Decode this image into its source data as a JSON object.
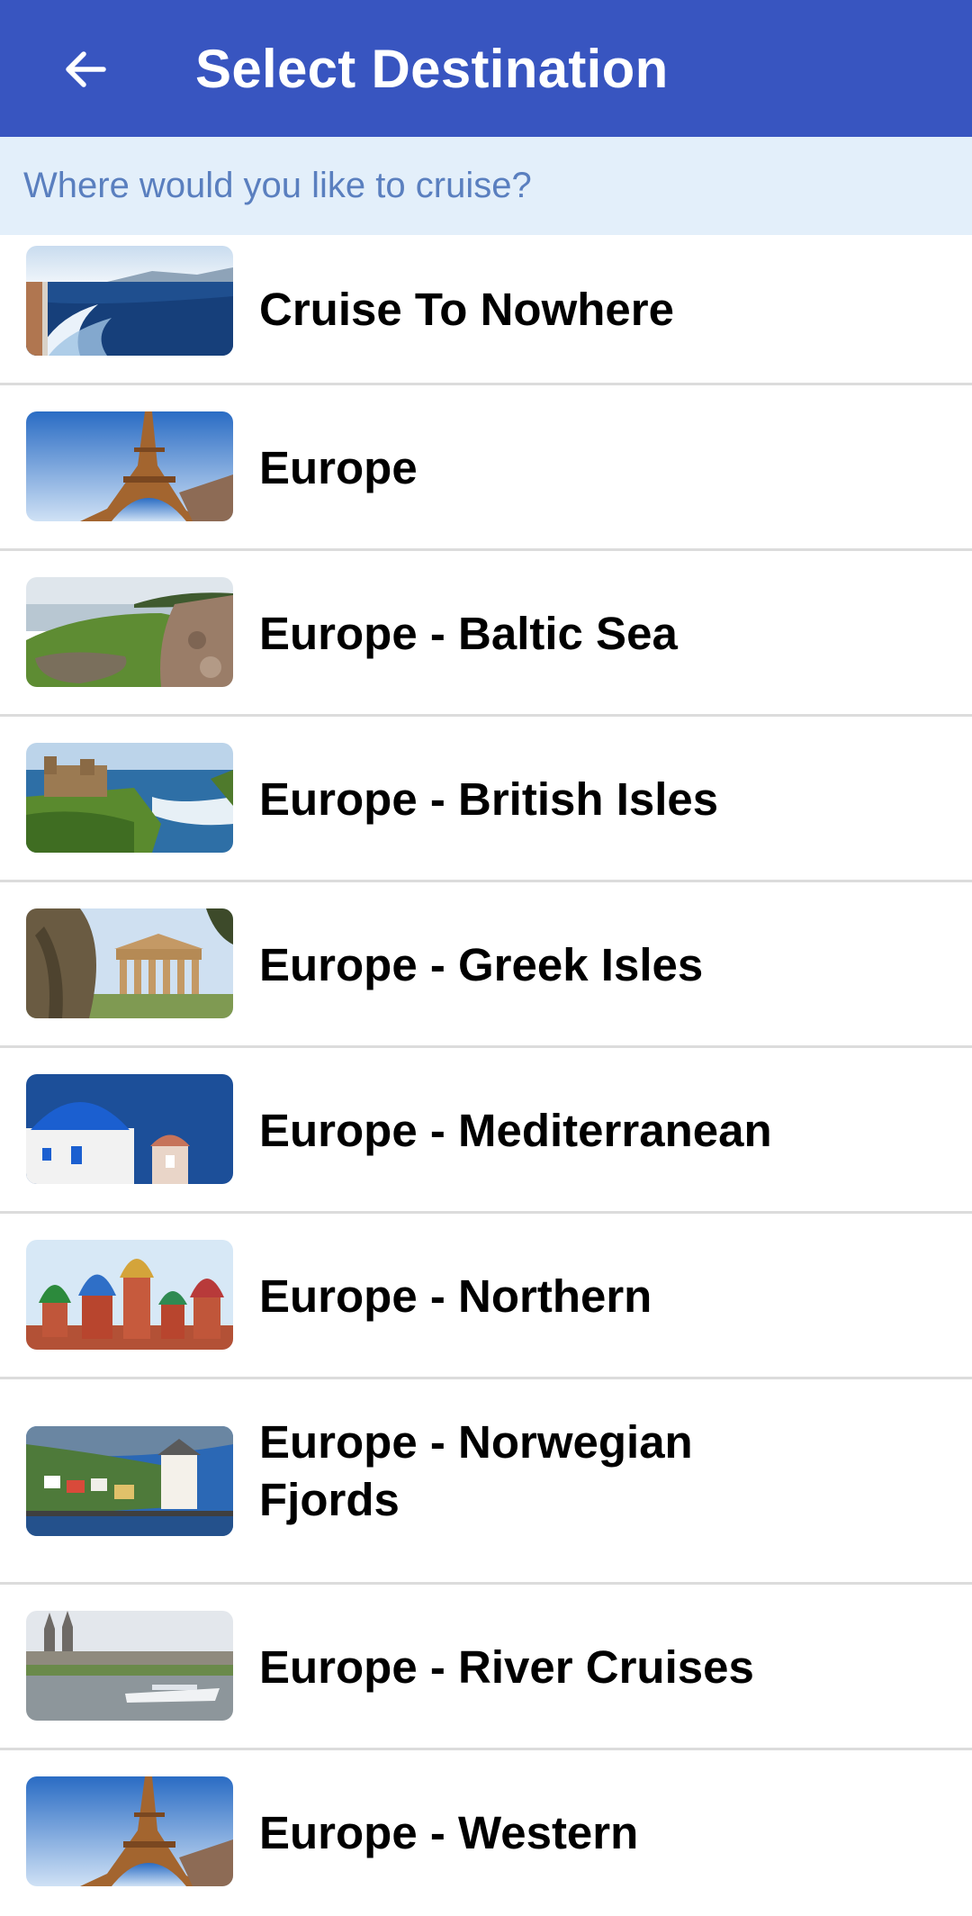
{
  "appbar": {
    "title": "Select Destination",
    "back_icon": "arrow-left-icon",
    "color": "#3855c0"
  },
  "subheader": {
    "text": "Where would you like to cruise?",
    "background": "#e3effa"
  },
  "destinations": [
    {
      "label": "Cruise To Nowhere",
      "image": "ocean-wake-photo"
    },
    {
      "label": "Europe",
      "image": "eiffel-tower-photo"
    },
    {
      "label": "Europe - Baltic Sea",
      "image": "baltic-coast-photo"
    },
    {
      "label": "Europe - British Isles",
      "image": "castle-cliffs-photo"
    },
    {
      "label": "Europe - Greek Isles",
      "image": "greek-temple-photo"
    },
    {
      "label": "Europe - Mediterranean",
      "image": "santorini-dome-photo"
    },
    {
      "label": "Europe - Northern",
      "image": "onion-domes-photo"
    },
    {
      "label": "Europe - Norwegian Fjords",
      "image": "fjord-town-photo"
    },
    {
      "label": "Europe - River Cruises",
      "image": "river-cathedral-photo"
    },
    {
      "label": "Europe - Western",
      "image": "eiffel-tower-photo"
    }
  ]
}
